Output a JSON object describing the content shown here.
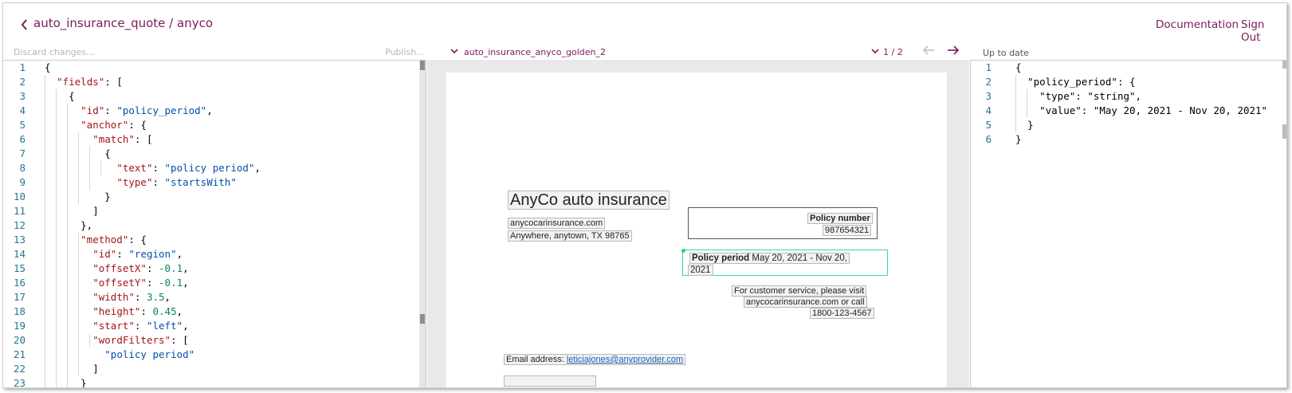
{
  "header": {
    "title": "auto_insurance_quote / anyco",
    "documentation": "Documentation",
    "sign_out": "Sign Out"
  },
  "toolbar": {
    "discard": "Discard changes...",
    "publish": "Publish...",
    "golden_name": "auto_insurance_anyco_golden_2",
    "page_indicator": "1 / 2",
    "status": "Up to date"
  },
  "left_editor": {
    "lines": [
      "1",
      "2",
      "3",
      "4",
      "5",
      "6",
      "7",
      "8",
      "9",
      "10",
      "11",
      "12",
      "13",
      "14",
      "15",
      "16",
      "17",
      "18",
      "19",
      "20",
      "21",
      "22",
      "23"
    ]
  },
  "right_editor": {
    "lines": [
      "1",
      "2",
      "3",
      "4",
      "5",
      "6"
    ]
  },
  "document": {
    "company": "AnyCo auto insurance",
    "website": "anycocarinsurance.com",
    "address": "Anywhere, anytown, TX 98765",
    "policy_number_label": "Policy number",
    "policy_number_value": "987654321",
    "policy_period_label": "Policy period",
    "policy_period_value_1": "May 20, 2021 - Nov 20,",
    "policy_period_value_2": "2021",
    "cs_line1": "For customer service, please visit",
    "cs_line2": "anycocarinsurance.com or call",
    "cs_line3": "1800-123-4567",
    "email_label": "Email address:",
    "email_value": "leticiajones@anyprovider.com"
  },
  "colors": {
    "accent": "#7a1b57",
    "key": "#a31515",
    "string": "#0451a5",
    "number": "#098658",
    "line_number": "#237893",
    "highlight": "#35d3b8"
  }
}
